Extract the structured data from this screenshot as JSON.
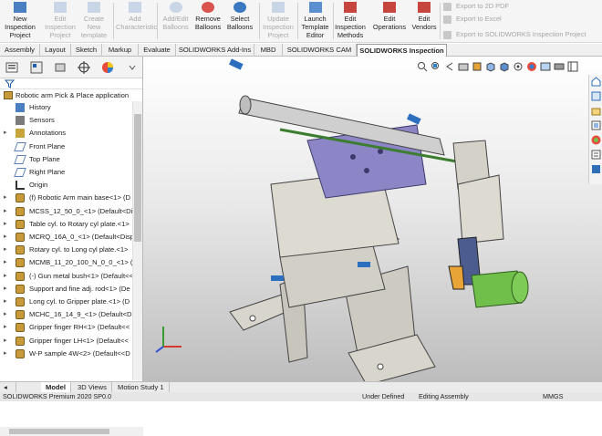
{
  "ribbon": {
    "buttons": [
      {
        "label": "New Inspection Project",
        "enabled": true
      },
      {
        "label": "Edit Inspection Project",
        "enabled": false
      },
      {
        "label": "Create New template",
        "enabled": false
      },
      {
        "label": "Add Characteristic",
        "enabled": false
      },
      {
        "label": "Add/Edit Balloons",
        "enabled": false
      },
      {
        "label": "Remove Balloons",
        "enabled": true
      },
      {
        "label": "Select Balloons",
        "enabled": true
      },
      {
        "label": "Update Inspection Project",
        "enabled": false
      },
      {
        "label": "Launch Template Editor",
        "enabled": true
      },
      {
        "label": "Edit Inspection Methods",
        "enabled": true
      },
      {
        "label": "Edit Operations",
        "enabled": true
      },
      {
        "label": "Edit Vendors",
        "enabled": true
      }
    ],
    "export": [
      "Export to 2D PDF",
      "Export to Excel",
      "Export to SOLIDWORKS Inspection Project"
    ]
  },
  "tabs": [
    "Assembly",
    "Layout",
    "Sketch",
    "Markup",
    "Evaluate",
    "SOLIDWORKS Add-Ins",
    "MBD",
    "SOLIDWORKS CAM",
    "SOLIDWORKS Inspection"
  ],
  "active_tab": "SOLIDWORKS Inspection",
  "tree": {
    "root": "Robotic arm Pick & Place application",
    "items": [
      {
        "label": "History",
        "icon": "history-icon",
        "expandable": false
      },
      {
        "label": "Sensors",
        "icon": "sensors-icon",
        "expandable": false
      },
      {
        "label": "Annotations",
        "icon": "annotations-icon",
        "expandable": true
      },
      {
        "label": "Front Plane",
        "icon": "plane-icon",
        "expandable": false
      },
      {
        "label": "Top Plane",
        "icon": "plane-icon",
        "expandable": false
      },
      {
        "label": "Right Plane",
        "icon": "plane-icon",
        "expandable": false
      },
      {
        "label": "Origin",
        "icon": "origin-icon",
        "expandable": false
      },
      {
        "label": "(f) Robotic Arm main base<1> (D",
        "icon": "part-icon",
        "expandable": true
      },
      {
        "label": "MCSS_12_50_0_<1> (Default<Disp",
        "icon": "part-icon",
        "expandable": true
      },
      {
        "label": "Table cyl. to Rotary cyl plate.<1>",
        "icon": "part-icon",
        "expandable": true
      },
      {
        "label": "MCRQ_16A_0_<1> (Default<Disp",
        "icon": "part-icon",
        "expandable": true
      },
      {
        "label": "Rotary cyl. to Long cyl plate.<1>",
        "icon": "part-icon",
        "expandable": true
      },
      {
        "label": "MCMB_11_20_100_N_0_0_<1> (D",
        "icon": "part-icon",
        "expandable": true
      },
      {
        "label": "(-) Gun metal bush<1> (Default<<",
        "icon": "part-icon",
        "expandable": true
      },
      {
        "label": "Support and fine adj. rod<1> (De",
        "icon": "part-icon",
        "expandable": true
      },
      {
        "label": "Long cyl. to Gripper plate.<1> (D",
        "icon": "part-icon",
        "expandable": true
      },
      {
        "label": "MCHC_16_14_9_<1> (Default<Dis",
        "icon": "part-icon",
        "expandable": true
      },
      {
        "label": "Gripper finger RH<1> (Default<<",
        "icon": "part-icon",
        "expandable": true
      },
      {
        "label": "Gripper finger LH<1> (Default<<",
        "icon": "part-icon",
        "expandable": true
      },
      {
        "label": "W-P sample 4W<2> (Default<<D",
        "icon": "part-icon",
        "expandable": true
      }
    ]
  },
  "bottom_tabs": [
    "Model",
    "3D Views",
    "Motion Study 1"
  ],
  "active_bottom_tab": "Model",
  "status": {
    "product": "SOLIDWORKS Premium 2020 SP0.0",
    "definition": "Under Defined",
    "mode": "Editing Assembly",
    "units": "MMGS"
  },
  "colors": {
    "accent": "#1f5fa8",
    "active_tab_text": "#000000",
    "model_purple": "#8c86c7",
    "model_green": "#6fbf4a",
    "model_gray": "#c8c6bc"
  }
}
